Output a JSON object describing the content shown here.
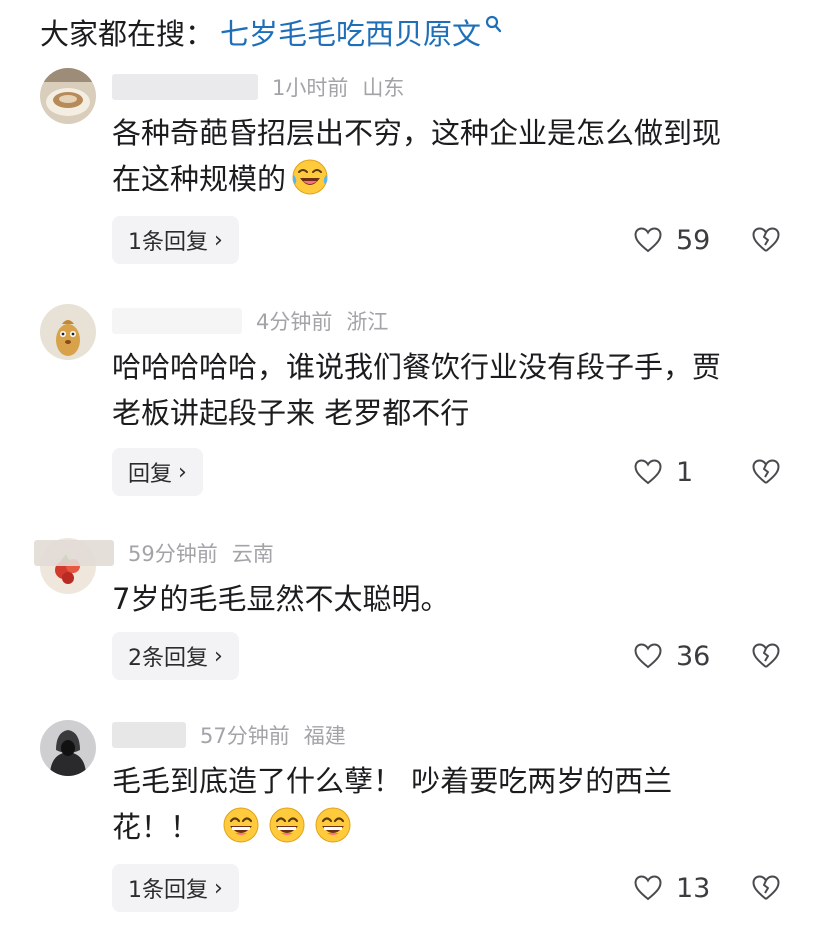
{
  "search": {
    "prefix": "大家都在搜：",
    "term": "七岁毛毛吃西贝原文"
  },
  "comments": [
    {
      "time": "1小时前",
      "location": "山东",
      "lines": [
        "各种奇葩昏招层出不穷，这种企业是怎么做到现",
        "在这种规模的"
      ],
      "emoji": [
        "laughing-crying-emoji"
      ],
      "reply_label": "1条回复",
      "likes": "59"
    },
    {
      "time": "4分钟前",
      "location": "浙江",
      "lines": [
        "哈哈哈哈哈，谁说我们餐饮行业没有段子手，贾",
        "老板讲起段子来 老罗都不行"
      ],
      "reply_label": "回复",
      "likes": "1"
    },
    {
      "time": "59分钟前",
      "location": "云南",
      "lines": [
        "7岁的毛毛显然不太聪明。"
      ],
      "reply_label": "2条回复",
      "likes": "36"
    },
    {
      "time": "57分钟前",
      "location": "福建",
      "lines": [
        "毛毛到底造了什么孽！ 吵着要吃两岁的西兰",
        "花！！"
      ],
      "emoji": [
        "grinning-emoji",
        "grinning-emoji",
        "grinning-emoji"
      ],
      "reply_label": "1条回复",
      "likes": "13"
    }
  ],
  "colors": {
    "search_term": "#1f6fb8",
    "meta_text": "#a3a3a8",
    "reply_bg": "#f3f3f5"
  }
}
